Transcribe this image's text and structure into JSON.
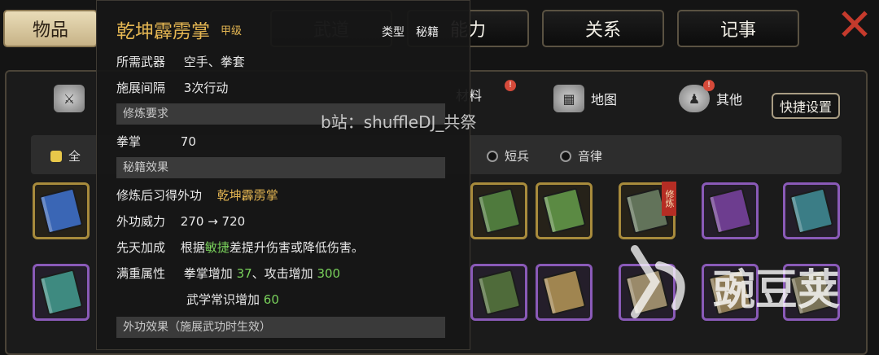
{
  "tabs": [
    {
      "label": "物品",
      "active": true
    },
    {
      "label": "武道",
      "active": false
    },
    {
      "label": "能力",
      "active": false
    },
    {
      "label": "关系",
      "active": false
    },
    {
      "label": "记事",
      "active": false
    }
  ],
  "categories": [
    {
      "label": "材料",
      "icon": "material-icon",
      "badge": "!"
    },
    {
      "label": "地图",
      "icon": "map-icon",
      "badge": ""
    },
    {
      "label": "其他",
      "icon": "other-icon",
      "badge": "!"
    }
  ],
  "quick_settings": "快捷设置",
  "filters": [
    {
      "label": "全",
      "selected": true
    },
    {
      "label": "短兵",
      "selected": false
    },
    {
      "label": "音律",
      "selected": false
    }
  ],
  "inventory": {
    "slot_tag": "修炼",
    "colors": {
      "gold_border": "#a88b3c",
      "purple_border": "#8a5ab8"
    }
  },
  "tooltip": {
    "title": "乾坤霹雳掌",
    "grade": "甲级",
    "type_label": "类型",
    "type_value": "秘籍",
    "weapon_label": "所需武器",
    "weapon_value": "空手、拳套",
    "interval_label": "施展间隔",
    "interval_value": "3次行动",
    "req_section": "修炼要求",
    "req_label": "拳掌",
    "req_value": "70",
    "effect_section": "秘籍效果",
    "learn_label": "修炼后习得外功",
    "learn_value": "乾坤霹雳掌",
    "power_label": "外功威力",
    "power_value": "270 → 720",
    "innate_label": "先天加成",
    "innate_pre": "根据",
    "innate_stat": "敏捷",
    "innate_post": "差提升伤害或降低伤害。",
    "full_label": "满重属性",
    "full_1a": "拳掌增加 ",
    "full_1b": "37",
    "full_1c": "、攻击增加 ",
    "full_1d": "300",
    "full_2a": "武学常识增加 ",
    "full_2b": "60",
    "outer_section": "外功效果（施展武功时生效）"
  },
  "watermark": "b站：shuffleDJ_共祭",
  "logo_text": "豌豆荚"
}
